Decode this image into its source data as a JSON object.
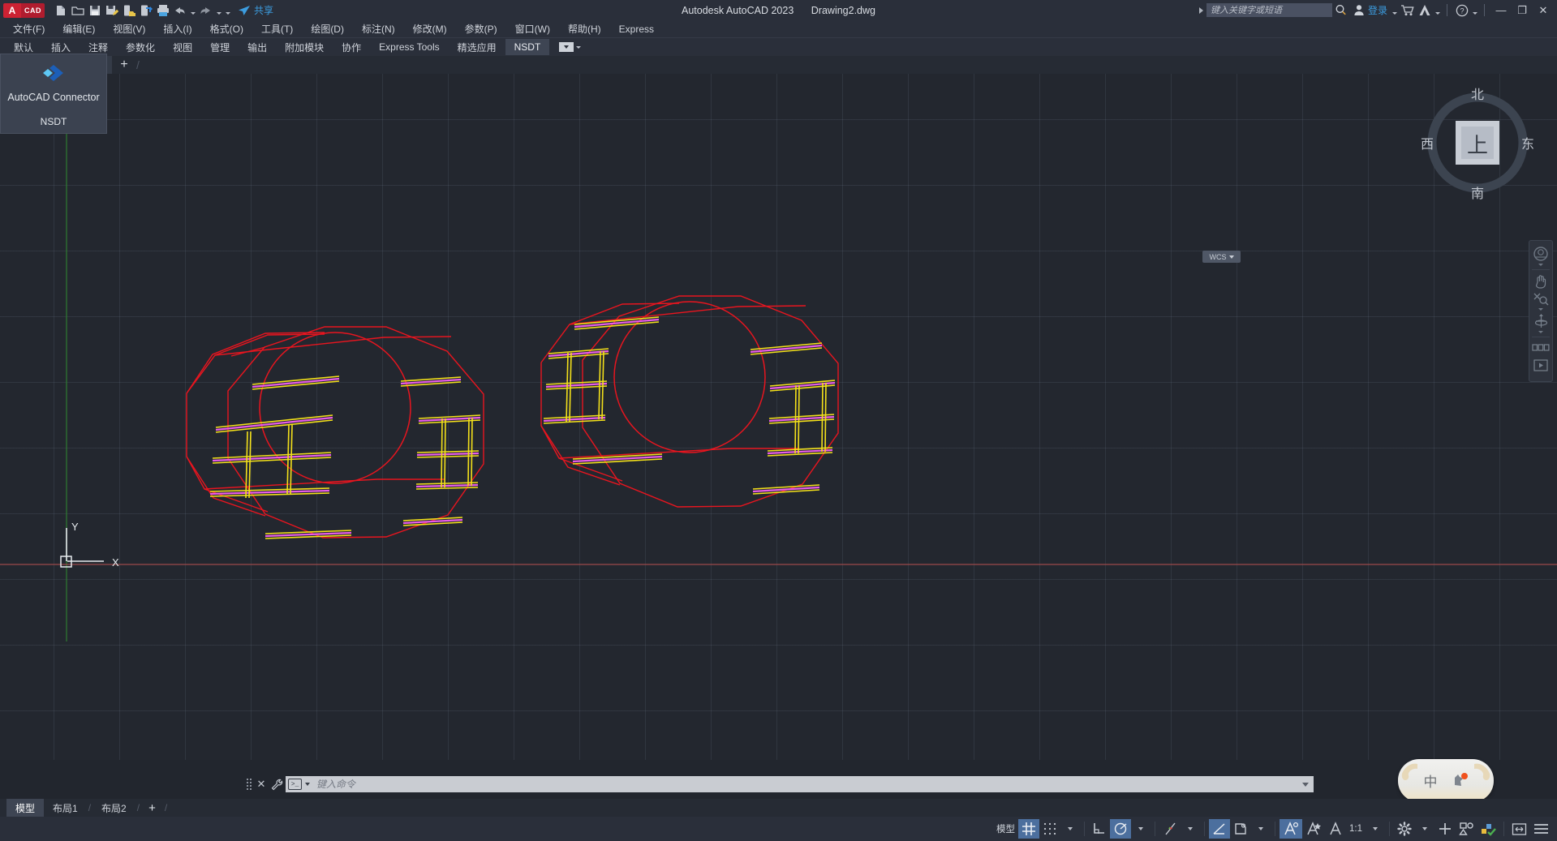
{
  "titlebar": {
    "logo_a": "A",
    "logo_cad": "CAD",
    "share_label": "共享",
    "app_title": "Autodesk AutoCAD 2023",
    "document_title": "Drawing2.dwg",
    "search_placeholder": "键入关键字或短语",
    "signin_label": "登录",
    "quick_access": [
      {
        "name": "new-file-icon",
        "label": "新建"
      },
      {
        "name": "open-file-icon",
        "label": "打开"
      },
      {
        "name": "save-icon",
        "label": "保存"
      },
      {
        "name": "save-as-icon",
        "label": "另存为"
      },
      {
        "name": "save-to-web-icon",
        "label": "保存到 Web 和 Mobile"
      },
      {
        "name": "open-from-web-icon",
        "label": "从 Web 和 Mobile 打开"
      },
      {
        "name": "plot-icon",
        "label": "打印"
      },
      {
        "name": "undo-icon",
        "label": "放弃"
      },
      {
        "name": "redo-icon",
        "label": "重做"
      }
    ],
    "window_buttons": {
      "minimize": "—",
      "restore": "❐",
      "close": "✕"
    }
  },
  "menubar": [
    {
      "text": "文件(F)",
      "key": "F"
    },
    {
      "text": "编辑(E)",
      "key": "E"
    },
    {
      "text": "视图(V)",
      "key": "V"
    },
    {
      "text": "插入(I)",
      "key": "I"
    },
    {
      "text": "格式(O)",
      "key": "O"
    },
    {
      "text": "工具(T)",
      "key": "T"
    },
    {
      "text": "绘图(D)",
      "key": "D"
    },
    {
      "text": "标注(N)",
      "key": "N"
    },
    {
      "text": "修改(M)",
      "key": "M"
    },
    {
      "text": "参数(P)",
      "key": "P"
    },
    {
      "text": "窗口(W)",
      "key": "W"
    },
    {
      "text": "帮助(H)",
      "key": "H"
    },
    {
      "text": "Express",
      "key": "x"
    }
  ],
  "ribbon_tabs": [
    {
      "label": "默认",
      "active": false
    },
    {
      "label": "插入",
      "active": false
    },
    {
      "label": "注释",
      "active": false
    },
    {
      "label": "参数化",
      "active": false
    },
    {
      "label": "视图",
      "active": false
    },
    {
      "label": "管理",
      "active": false
    },
    {
      "label": "输出",
      "active": false
    },
    {
      "label": "附加模块",
      "active": false
    },
    {
      "label": "协作",
      "active": false
    },
    {
      "label": "Express Tools",
      "active": false
    },
    {
      "label": "精选应用",
      "active": false
    },
    {
      "label": "NSDT",
      "active": true
    }
  ],
  "nsdt_panel": {
    "title": "AutoCAD Connector",
    "subtitle": "NSDT"
  },
  "doctab": {
    "close_label": "✕",
    "add_label": "+"
  },
  "viewcube": {
    "top": "上",
    "north": "北",
    "south": "南",
    "east": "东",
    "west": "西",
    "ucs_label": "WCS"
  },
  "navbar": [
    {
      "name": "steering-wheel-icon",
      "label": "全导航控制盘"
    },
    {
      "name": "pan-hand-icon",
      "label": "平移"
    },
    {
      "name": "zoom-extents-icon",
      "label": "缩放"
    },
    {
      "name": "orbit-icon",
      "label": "动态观察"
    },
    {
      "name": "showmotion-icon",
      "label": "ShowMotion"
    }
  ],
  "ucs_icon": {
    "x_label": "X",
    "y_label": "Y"
  },
  "commandline": {
    "placeholder": "键入命令",
    "prompt_glyph": ">_",
    "close_label": "✕"
  },
  "ime": {
    "mode": "中"
  },
  "layout_tabs": [
    {
      "label": "模型",
      "active": true
    },
    {
      "label": "布局1",
      "active": false
    },
    {
      "label": "布局2",
      "active": false
    }
  ],
  "layout_add_label": "+",
  "statusbar": {
    "model_label": "模型",
    "scale_label": "1:1",
    "items": [
      {
        "name": "model-space-button",
        "label": "模型",
        "on": false,
        "type": "text"
      },
      {
        "name": "grid-display-toggle",
        "label": "栅格",
        "on": true,
        "type": "icon"
      },
      {
        "name": "snap-mode-toggle",
        "label": "捕捉模式",
        "on": false,
        "type": "icon"
      },
      {
        "name": "ortho-mode-toggle",
        "label": "正交模式",
        "on": false,
        "type": "icon"
      },
      {
        "name": "polar-tracking-toggle",
        "label": "极轴追踪",
        "on": true,
        "type": "icon"
      },
      {
        "name": "object-snap-tracking-toggle",
        "label": "对象捕捉追踪",
        "on": false,
        "type": "icon"
      },
      {
        "name": "object-snap-toggle",
        "label": "对象捕捉",
        "on": true,
        "type": "icon"
      },
      {
        "name": "annotation-visibility-toggle",
        "label": "注释可见性",
        "on": false,
        "type": "icon"
      },
      {
        "name": "autoscale-toggle",
        "label": "自动缩放",
        "on": true,
        "type": "icon"
      },
      {
        "name": "annotation-scale-icon",
        "label": "注释比例",
        "on": false,
        "type": "icon"
      },
      {
        "name": "workspace-switch-button",
        "label": "切换工作空间",
        "on": false,
        "type": "icon"
      },
      {
        "name": "annotation-monitor-button",
        "label": "注释监视器",
        "on": false,
        "type": "icon"
      },
      {
        "name": "isolate-objects-button",
        "label": "隔离对象",
        "on": false,
        "type": "icon"
      },
      {
        "name": "hardware-acceleration-button",
        "label": "硬件加速",
        "on": false,
        "type": "icon"
      },
      {
        "name": "fullscreen-button",
        "label": "全屏显示",
        "on": false,
        "type": "icon"
      },
      {
        "name": "customization-button",
        "label": "自定义",
        "on": false,
        "type": "icon"
      }
    ]
  },
  "drawing": {
    "description": "两个红色八棱柱线框实体，中间带圆形截面，内部为黄色与品红色钢筋网格",
    "colors": {
      "solid_outline": "#e8151f",
      "rebar_yellow": "#f4e11a",
      "rebar_magenta": "#e85ce8",
      "axis_x": "#b05050",
      "axis_y": "#2e7d32",
      "background": "#23272f",
      "grid": "#7a869c"
    }
  }
}
